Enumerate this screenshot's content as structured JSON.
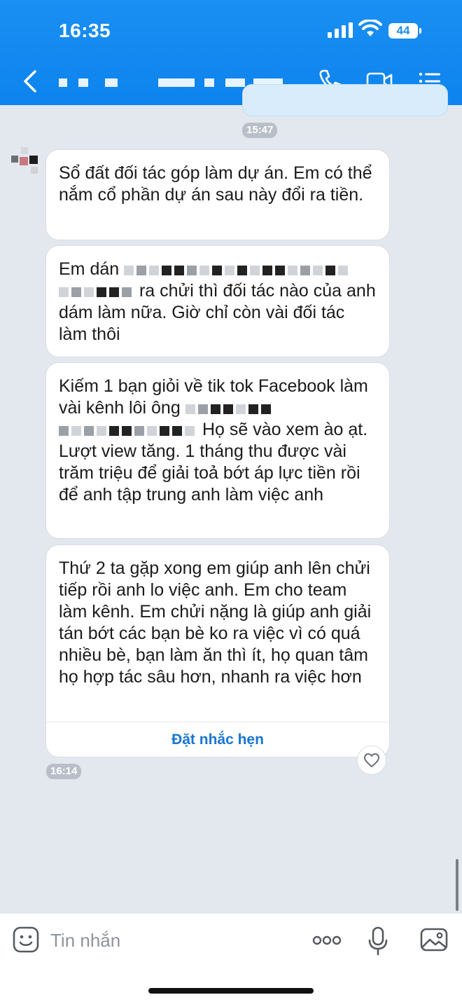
{
  "status_bar": {
    "time": "16:35",
    "battery": "44"
  },
  "header": {
    "contact_name": ""
  },
  "colors": {
    "header_blue": "#0d83ee",
    "link_blue": "#1976d2",
    "chat_bg": "#e3e8ef"
  },
  "icons": [
    "chevron-left-icon",
    "phone-icon",
    "video-call-icon",
    "list-menu-icon",
    "emoji-icon",
    "more-dots-icon",
    "microphone-icon",
    "image-icon",
    "heart-icon"
  ],
  "chat": {
    "time_1547": "15:47",
    "time_1614": "16:14",
    "messages": [
      {
        "text": "Sổ đất đối tác góp làm dự án. Em có thể nắm cổ phần dự án sau này đổi ra tiền."
      },
      {
        "part1": "Em dán",
        "part2": "ra chửi thì đối tác nào của anh dám làm nữa. Giờ chỉ còn vài đối tác làm thôi"
      },
      {
        "part1": "Kiếm 1 bạn giỏi về tik tok Facebook làm vài kênh lôi ông",
        "part2": "Họ sẽ vào xem ào ạt. Lượt view tăng. 1 tháng thu được vài trăm triệu để giải toả bớt áp lực tiền rồi để anh tập trung anh làm việc anh"
      },
      {
        "text": "Thứ 2 ta gặp xong em giúp anh lên chửi tiếp rồi anh lo việc anh. Em cho team làm kênh. Em chửi nặng là giúp anh giải tán bớt các bạn bè ko ra việc vì có quá nhiều bè, bạn làm ăn thì ít, họ quan tâm họ hợp tác sâu hơn, nhanh ra việc hơn",
        "reminder": "Đặt nhắc hẹn"
      }
    ]
  },
  "input": {
    "placeholder": "Tin nhắn"
  }
}
